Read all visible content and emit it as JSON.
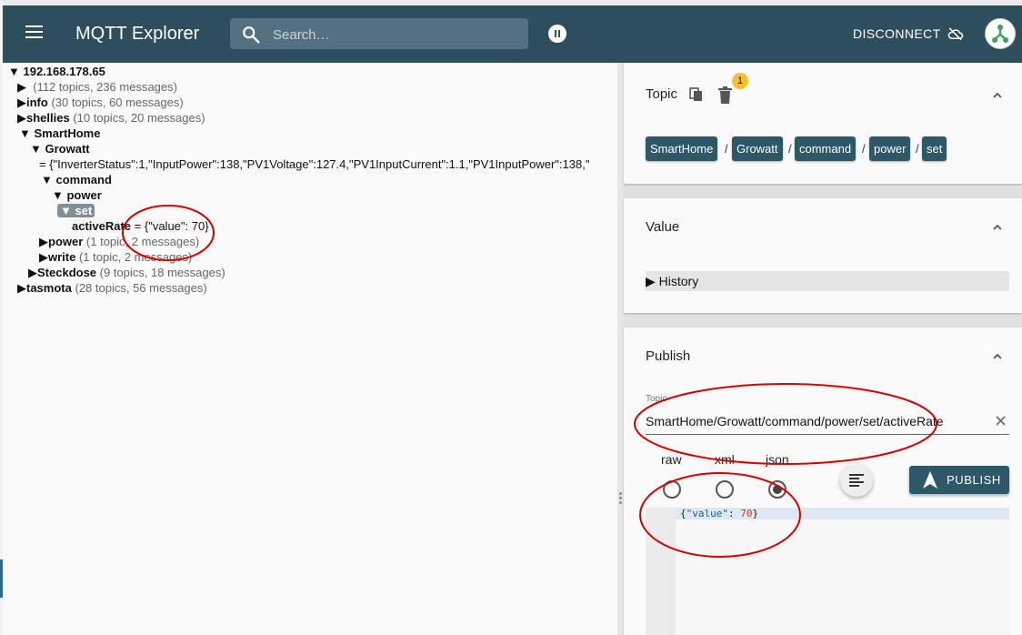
{
  "app": {
    "title": "MQTT Explorer"
  },
  "header": {
    "search_placeholder": "Search…",
    "disconnect_label": "DISCONNECT",
    "icons": [
      "menu-icon",
      "search-icon",
      "pause-icon",
      "cloud-off-icon",
      "broker-logo-icon"
    ],
    "bar_color": "#2c4f5b"
  },
  "tree": {
    "root": "▼ 192.168.178.65",
    "unnamed_meta": "(112 topics, 236 messages)",
    "info": {
      "label": "info",
      "meta": "(30 topics, 60 messages)"
    },
    "shellies": {
      "label": "shellies",
      "meta": "(10 topics, 20 messages)"
    },
    "smarthome": {
      "label": "SmartHome"
    },
    "growatt": {
      "label": "Growatt",
      "value": "= {\"InverterStatus\":1,\"InputPower\":138,\"PV1Voltage\":127.4,\"PV1InputCurrent\":1.1,\"PV1InputPower\":138,\""
    },
    "command": {
      "label": "command"
    },
    "power_inner": {
      "label": "power"
    },
    "set": {
      "label": "▼ set"
    },
    "active_rate": {
      "label": "activeRate",
      "value": "= {\"value\": 70}"
    },
    "power": {
      "label": "power",
      "meta": "(1 topic, 2 messages)"
    },
    "write": {
      "label": "write",
      "meta": "(1 topic, 2 messages)"
    },
    "steckdose": {
      "label": "Steckdose",
      "meta": "(9 topics, 18 messages)"
    },
    "tasmota": {
      "label": "tasmota",
      "meta": "(28 topics, 56 messages)"
    }
  },
  "topic_card": {
    "title": "Topic",
    "badge": "1",
    "breadcrumbs": [
      "SmartHome",
      "Growatt",
      "command",
      "power",
      "set"
    ],
    "separator": "/"
  },
  "value_card": {
    "title": "Value",
    "history_label": "▶ History"
  },
  "publish_card": {
    "title": "Publish",
    "topic_label": "Topic",
    "topic_value": "SmartHome/Growatt/command/power/set/activeRate",
    "formats": [
      "raw",
      "xml",
      "json"
    ],
    "selected_format": "json",
    "publish_label": "PUBLISH",
    "editor": {
      "key": "\"value\"",
      "number": "70"
    }
  },
  "colors": {
    "accent": "#2c5867",
    "badge": "#f7c02a",
    "annotation": "#d40000"
  }
}
